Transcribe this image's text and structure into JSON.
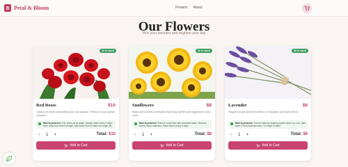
{
  "brand": {
    "name": "Petal & Bloom",
    "initial": "B"
  },
  "nav": {
    "links": [
      "Flowers",
      "About"
    ]
  },
  "page": {
    "title": "Our Flowers",
    "subtitle": "Pick your favorites and brighten your day"
  },
  "colors": {
    "accent": "#c13c65",
    "stock": "#3c9b5e"
  },
  "products": [
    {
      "name": "Red Roses",
      "price": "$10",
      "stock": "16 in stock",
      "description": "Classic red roses symbolizing love and passion. Perfect for any special occasion.",
      "care_label": "How to preserve:",
      "care_text": "Trim stems at an angle, change water every 2 days, keep away from direct sunlight. Add flower food to water for longer life.",
      "quantity": "1",
      "total_label": "Total:",
      "total": "$10",
      "button": "Add to Cart"
    },
    {
      "name": "Sunflowers",
      "price": "$8",
      "stock": "16 in stock",
      "description": "Bright and cheerful sunflowers that bring warmth and happiness to any room.",
      "care_label": "How to preserve:",
      "care_text": "Place in a tall vase with lukewarm water. Remove leaves below waterline. Recut stems every 3 days.",
      "quantity": "1",
      "total_label": "Total:",
      "total": "$8",
      "button": "Add to Cart"
    },
    {
      "name": "Lavender",
      "price": "$6",
      "stock": "48 in stock",
      "description": "Fragrant purple lavender perfect for relaxation and home décor.",
      "care_label": "How to preserve:",
      "care_text": "Can be dried by hanging upside down in a cool, dark place. Fresh lavender lasts 7-10 days in water.",
      "quantity": "1",
      "total_label": "Total:",
      "total": "$6",
      "button": "Add to Cart"
    }
  ]
}
